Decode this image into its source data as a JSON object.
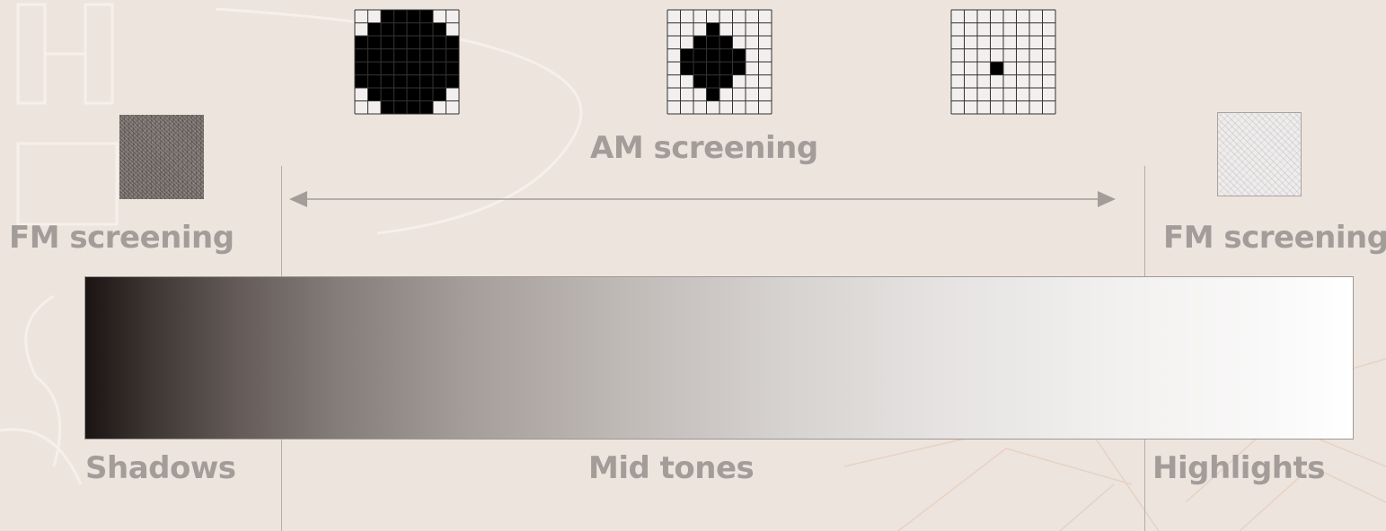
{
  "labels": {
    "am_screening": "AM screening",
    "fm_screening_left": "FM screening",
    "fm_screening_right": "FM screening",
    "shadows": "Shadows",
    "mid_tones": "Mid tones",
    "highlights": "Highlights"
  },
  "am_dots": [
    {
      "name": "am-dot-large",
      "rows": 8,
      "cols": 8,
      "filled": [
        "..####..",
        ".######.",
        "########",
        "########",
        "########",
        "########",
        ".######.",
        "..####.."
      ]
    },
    {
      "name": "am-dot-medium",
      "rows": 8,
      "cols": 8,
      "filled": [
        "........",
        "...#....",
        "..###...",
        ".#####..",
        ".#####..",
        "..###...",
        "...#....",
        "........"
      ]
    },
    {
      "name": "am-dot-small",
      "rows": 8,
      "cols": 8,
      "filled": [
        "........",
        "........",
        "........",
        "........",
        "...#....",
        "........",
        "........",
        "........"
      ]
    }
  ],
  "colors": {
    "background": "#ede4de",
    "label_text": "#a39c98",
    "guide_line": "#b4aca7",
    "grid_line": "#333333",
    "dot_fill": "#000000",
    "cell_empty": "#f2efee"
  },
  "gradient": {
    "from": "#1a1412",
    "to": "#ffffff",
    "direction": "dark-to-light"
  }
}
